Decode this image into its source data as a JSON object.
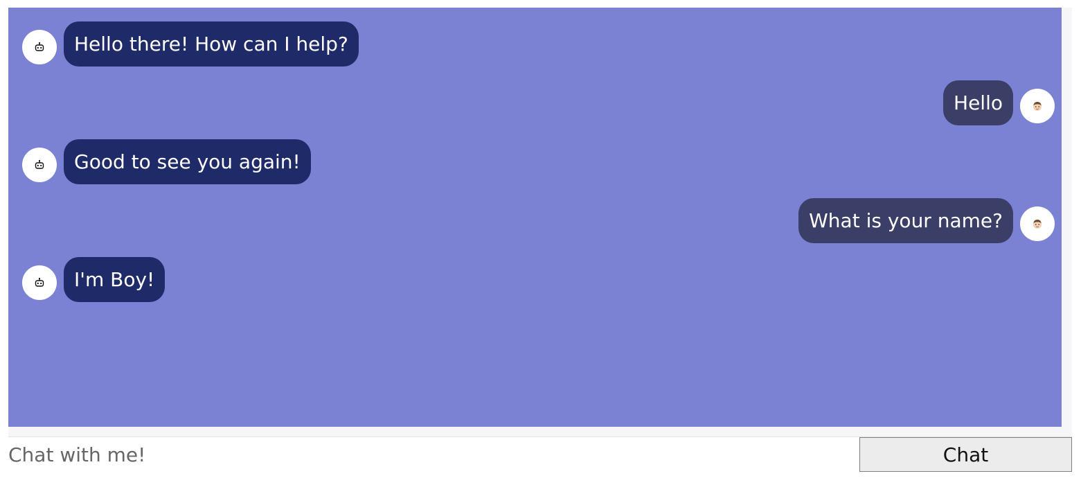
{
  "chat": {
    "messages": [
      {
        "sender": "bot",
        "text": "Hello there! How can I help?",
        "avatar_icon": "robot-icon"
      },
      {
        "sender": "user",
        "text": "Hello",
        "avatar_icon": "man-face-icon"
      },
      {
        "sender": "bot",
        "text": "Good to see you again!",
        "avatar_icon": "robot-icon"
      },
      {
        "sender": "user",
        "text": "What is your name?",
        "avatar_icon": "man-face-icon"
      },
      {
        "sender": "bot",
        "text": "I'm Boy!",
        "avatar_icon": "robot-icon"
      }
    ]
  },
  "input": {
    "placeholder": "Chat with me!",
    "value": ""
  },
  "send_button": {
    "label": "Chat"
  },
  "colors": {
    "chat_background": "#7b82d3",
    "bot_bubble": "#1f2a68",
    "user_bubble": "#3b3e66",
    "bubble_text": "#ffffff"
  }
}
